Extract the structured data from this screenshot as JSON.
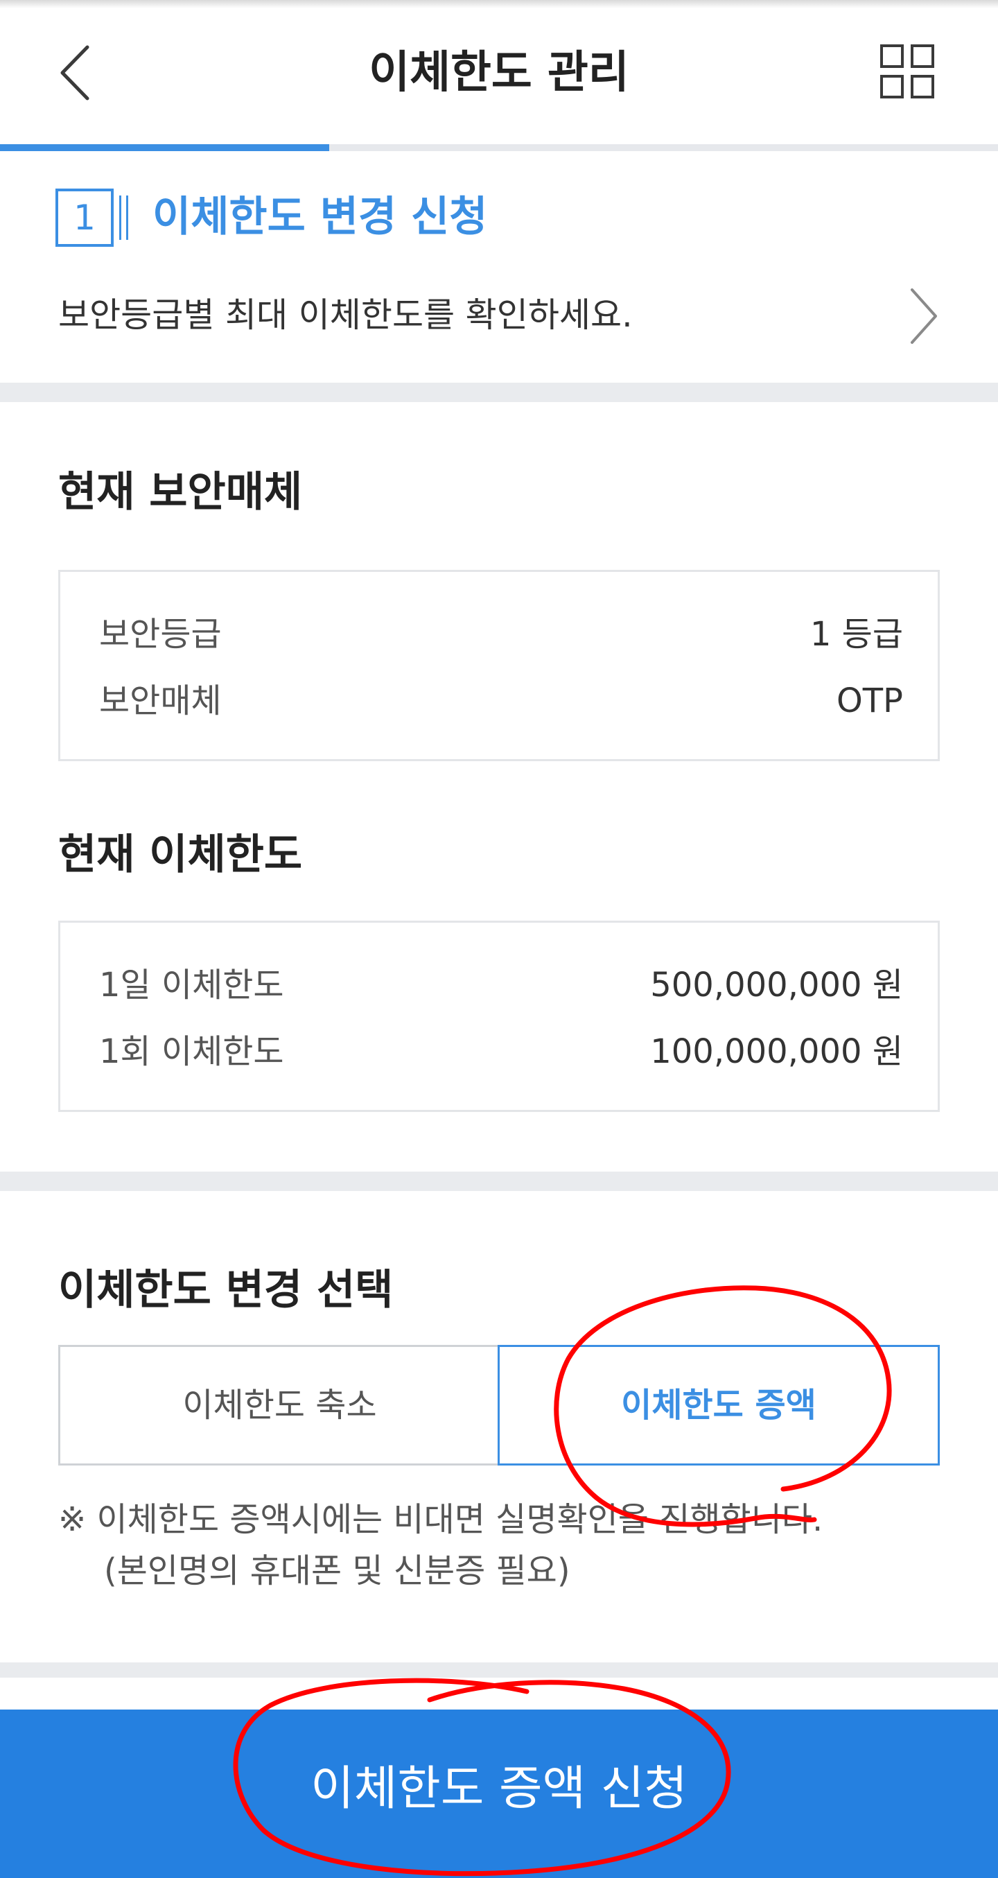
{
  "header": {
    "title": "이체한도 관리",
    "back_icon": "chevron-left-icon",
    "menu_icon": "grid-menu-icon"
  },
  "progress": {
    "fraction": 0.33
  },
  "step": {
    "number": "1",
    "title": "이체한도 변경 신청",
    "description": "보안등급별 최대 이체한도를 확인하세요."
  },
  "security": {
    "title": "현재 보안매체",
    "rows": [
      {
        "label": "보안등급",
        "value": "1 등급"
      },
      {
        "label": "보안매체",
        "value": "OTP"
      }
    ]
  },
  "limits": {
    "title": "현재 이체한도",
    "rows": [
      {
        "label": "1일 이체한도",
        "value": "500,000,000 원"
      },
      {
        "label": "1회 이체한도",
        "value": "100,000,000 원"
      }
    ]
  },
  "change": {
    "title": "이체한도 변경 선택",
    "options": [
      "이체한도 축소",
      "이체한도 증액"
    ],
    "selected": "이체한도 증액",
    "notice_line1": "※ 이체한도 증액시에는 비대면 실명확인을 진행합니다.",
    "notice_line2": "(본인명의 휴대폰 및 신분증 필요)"
  },
  "cta": {
    "label": "이체한도 증액 신청"
  },
  "colors": {
    "accent": "#3b8fe3",
    "cta_background": "#2580e0",
    "divider": "#e9ebee",
    "annotation": "#ff0000"
  }
}
